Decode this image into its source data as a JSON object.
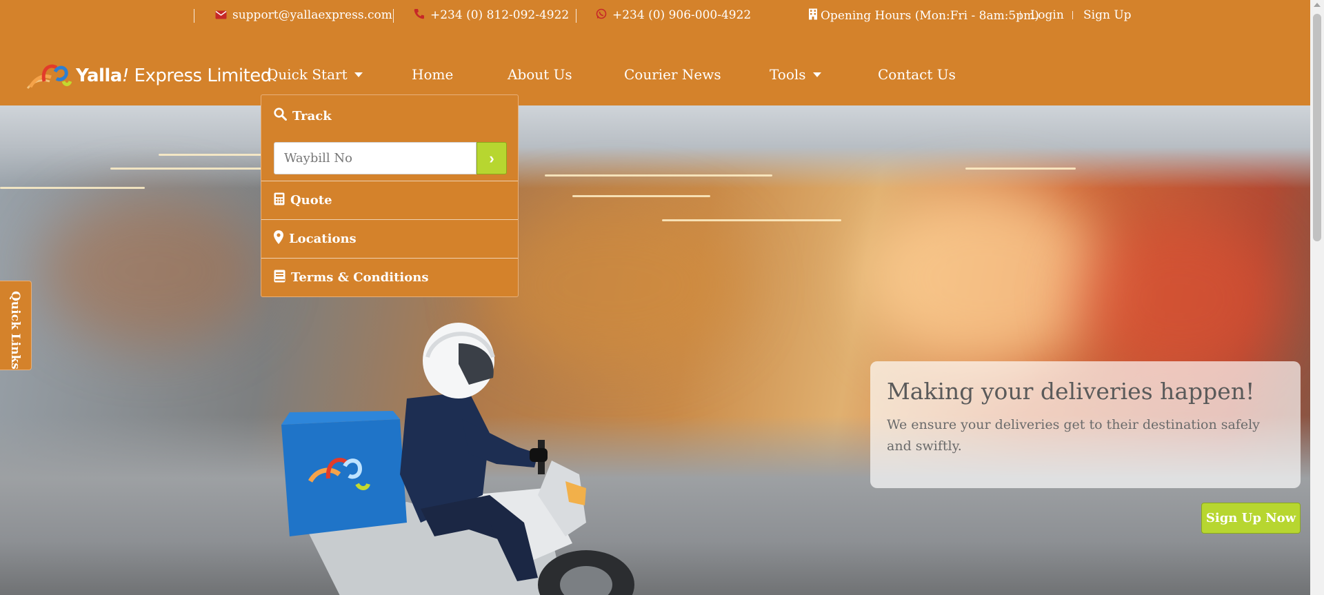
{
  "topbar": {
    "email": "support@yallaexpress.com",
    "phone": "+234 (0) 812-092-4922",
    "whatsapp": "+234 (0) 906-000-4922",
    "hours": "Opening Hours (Mon:Fri - 8am:5pm)",
    "login": "Login",
    "signup": "Sign Up"
  },
  "brand": {
    "name_bold": "Yalla",
    "name_bang": "!",
    "name_rest": " Express Limited"
  },
  "nav": {
    "quick_start": "Quick Start",
    "home": "Home",
    "about": "About Us",
    "news": "Courier News",
    "tools": "Tools",
    "contact": "Contact Us"
  },
  "dropdown": {
    "track": "Track",
    "waybill_placeholder": "Waybill No",
    "go_glyph": "›",
    "quote": "Quote",
    "locations": "Locations",
    "terms": "Terms & Conditions"
  },
  "quick_links": "Quick Links",
  "hero": {
    "heading": "Making your deliveries happen!",
    "text": "We ensure your deliveries get to their destination safely and swiftly.",
    "cta": "Sign Up Now"
  },
  "colors": {
    "brand_orange": "#d4822b",
    "accent_green": "#b7d630",
    "icon_red": "#c62828"
  },
  "icons": [
    "envelope-icon",
    "phone-icon",
    "whatsapp-icon",
    "building-icon",
    "search-icon",
    "calculator-icon",
    "map-marker-icon",
    "book-icon",
    "chevron-right-icon",
    "caret-down-icon"
  ]
}
